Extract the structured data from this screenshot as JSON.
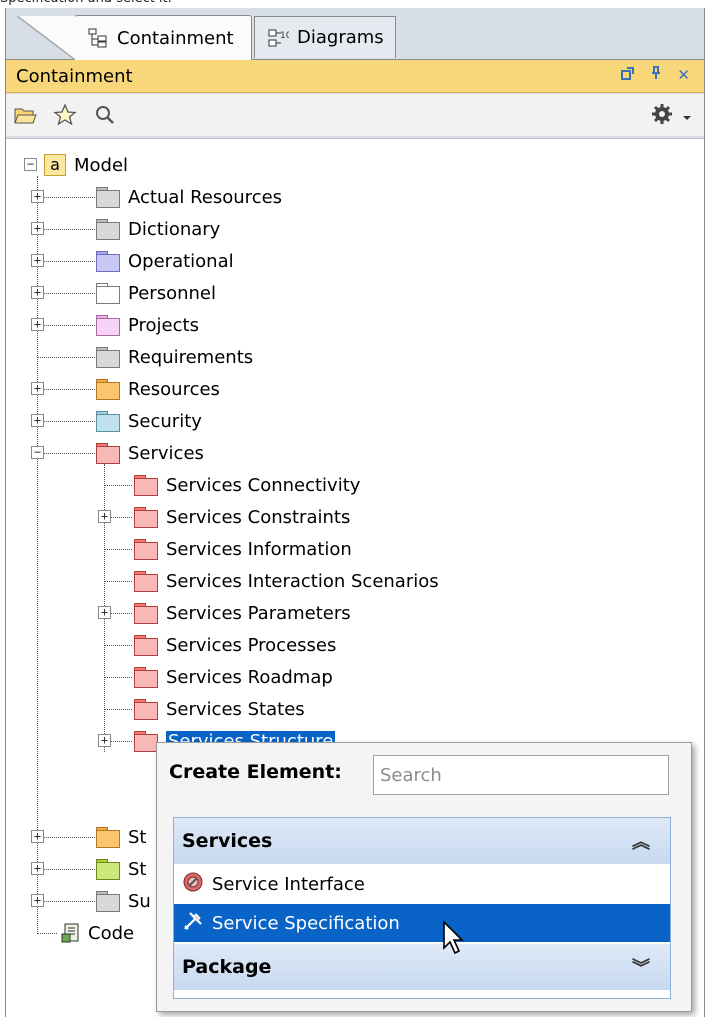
{
  "caption": "Specification and select it.",
  "tabs": [
    {
      "label": "Containment",
      "active": true,
      "icon": "containment-tree-icon"
    },
    {
      "label": "Diagrams",
      "active": false,
      "icon": "diagrams-icon"
    }
  ],
  "panel": {
    "title": "Containment",
    "controls": [
      "float-icon",
      "pin-icon",
      "close-icon"
    ],
    "close_glyph": "✕",
    "toolbar": [
      "open-folder-icon",
      "star-icon",
      "search-icon",
      "gear-icon",
      "dropdown-icon"
    ]
  },
  "tree": {
    "root": {
      "label": "Model",
      "icon": "a",
      "expanded": true
    },
    "children": [
      {
        "label": "Actual Resources",
        "expander": "+",
        "color": "gray"
      },
      {
        "label": "Dictionary",
        "expander": "+",
        "color": "gray"
      },
      {
        "label": "Operational",
        "expander": "+",
        "color": "lavender"
      },
      {
        "label": "Personnel",
        "expander": "+",
        "color": "white"
      },
      {
        "label": "Projects",
        "expander": "+",
        "color": "pink"
      },
      {
        "label": "Requirements",
        "expander": "",
        "color": "gray"
      },
      {
        "label": "Resources",
        "expander": "+",
        "color": "orange"
      },
      {
        "label": "Security",
        "expander": "+",
        "color": "cyan"
      },
      {
        "label": "Services",
        "expander": "−",
        "color": "red"
      }
    ],
    "services_children": [
      {
        "label": "Services Connectivity",
        "expander": ""
      },
      {
        "label": "Services Constraints",
        "expander": "+"
      },
      {
        "label": "Services Information",
        "expander": ""
      },
      {
        "label": "Services Interaction Scenarios",
        "expander": ""
      },
      {
        "label": "Services Parameters",
        "expander": "+"
      },
      {
        "label": "Services Processes",
        "expander": ""
      },
      {
        "label": "Services Roadmap",
        "expander": ""
      },
      {
        "label": "Services States",
        "expander": ""
      },
      {
        "label": "Services Structure",
        "expander": "+",
        "selected": true
      }
    ],
    "partial": [
      {
        "label": "St",
        "color": "orange"
      },
      {
        "label": "St",
        "color": "green"
      },
      {
        "label": "Su",
        "color": "gray"
      }
    ],
    "code": {
      "label": "Code"
    }
  },
  "popup": {
    "header": "Create Element:",
    "search_placeholder": "Search",
    "categories": [
      {
        "label": "Services",
        "chevron": "︽",
        "expanded": true,
        "items": [
          {
            "label": "Service Interface",
            "icon": "service-interface-icon"
          },
          {
            "label": "Service Specification",
            "icon": "service-specification-icon",
            "selected": true
          }
        ]
      },
      {
        "label": "Package",
        "chevron": "︾",
        "expanded": false
      }
    ]
  },
  "colors": {
    "accent": "#0a64c8",
    "title_bar": "#f8d77b",
    "folder_red": "#f9b8b8",
    "folder_gray": "#cfcfcf"
  }
}
